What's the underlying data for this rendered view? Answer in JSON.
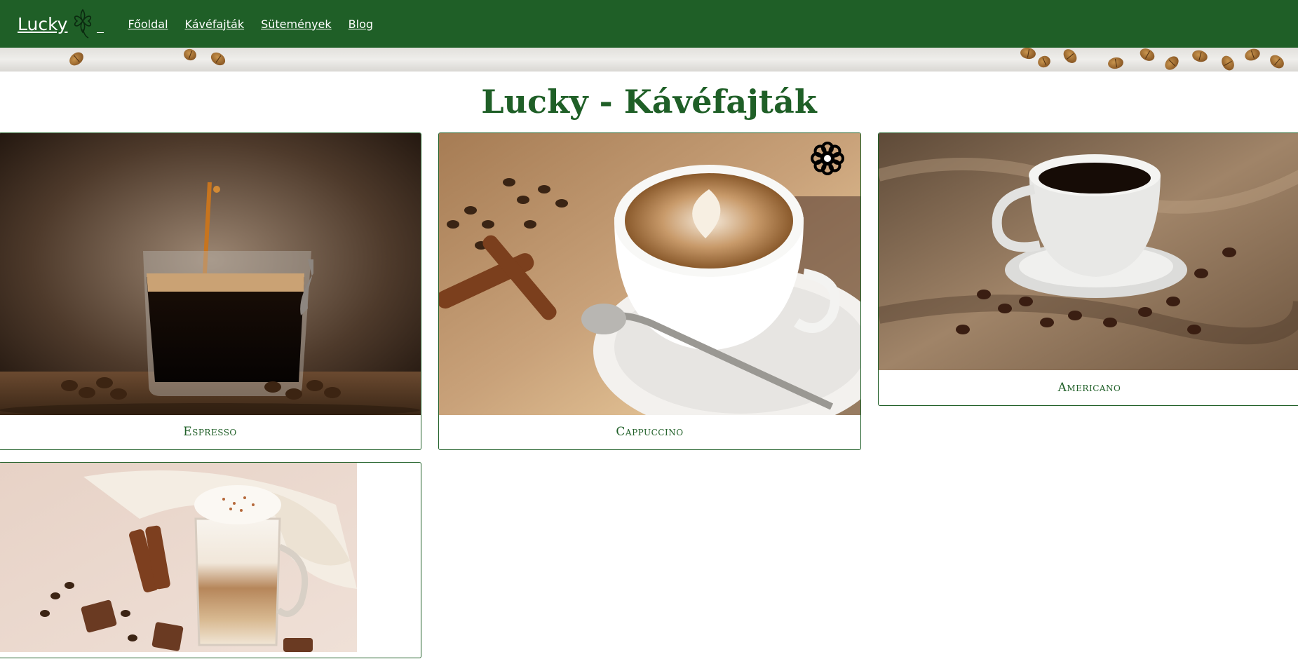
{
  "nav": {
    "brand": "Lucky",
    "links": [
      "Főoldal",
      "Kávéfajták",
      "Sütemények",
      "Blog"
    ]
  },
  "page": {
    "title": "Lucky - Kávéfajták"
  },
  "cards": [
    {
      "label": "Espresso"
    },
    {
      "label": "Cappuccino"
    },
    {
      "label": "Americano"
    }
  ],
  "colors": {
    "brand_green": "#1f5f27",
    "white": "#ffffff"
  }
}
